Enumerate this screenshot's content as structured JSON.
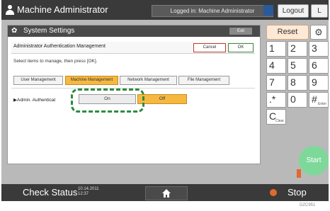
{
  "header": {
    "title": "Machine Administrator",
    "login_status": "Logged in: Machine Administrator",
    "logout_label": "Logout",
    "right_button_label": "L"
  },
  "dialog": {
    "title": "System Settings",
    "exit_label": "Exit",
    "section_title": "Administrator Authentication Management",
    "cancel_label": "Cancel",
    "ok_label": "OK",
    "instruction": "Select items to manage, then press [OK].",
    "tabs": [
      {
        "label": "User Management",
        "selected": false
      },
      {
        "label": "Machine Management",
        "selected": true
      },
      {
        "label": "Network Management",
        "selected": false
      },
      {
        "label": "File Management",
        "selected": false
      }
    ],
    "admin_auth_label": "▶Admin. Authenticat",
    "on_label": "On",
    "off_label": "Off",
    "off_selected": true
  },
  "panel": {
    "reset_label": "Reset",
    "keys": [
      {
        "label": "1",
        "sub": ""
      },
      {
        "label": "2",
        "sub": ""
      },
      {
        "label": "3",
        "sub": ""
      },
      {
        "label": "4",
        "sub": ""
      },
      {
        "label": "5",
        "sub": ""
      },
      {
        "label": "6",
        "sub": ""
      },
      {
        "label": "7",
        "sub": ""
      },
      {
        "label": "8",
        "sub": ""
      },
      {
        "label": "9",
        "sub": ""
      },
      {
        "label": ".*",
        "sub": ""
      },
      {
        "label": "0",
        "sub": ""
      },
      {
        "label": "#",
        "sub": "Enter"
      },
      {
        "label": "C",
        "sub": "Clear"
      }
    ],
    "start_label": "Start"
  },
  "footer": {
    "check_status_label": "Check Status",
    "date": "10.14.2011",
    "time": "12:37",
    "stop_label": "Stop"
  },
  "image_code": "DZC951",
  "colors": {
    "selected_tab": "#f5b942",
    "highlight": "#2e8b3e",
    "start": "#7ed89a",
    "stop": "#e06a2a"
  },
  "icons": [
    "user-icon",
    "gear-icon",
    "home-icon"
  ]
}
